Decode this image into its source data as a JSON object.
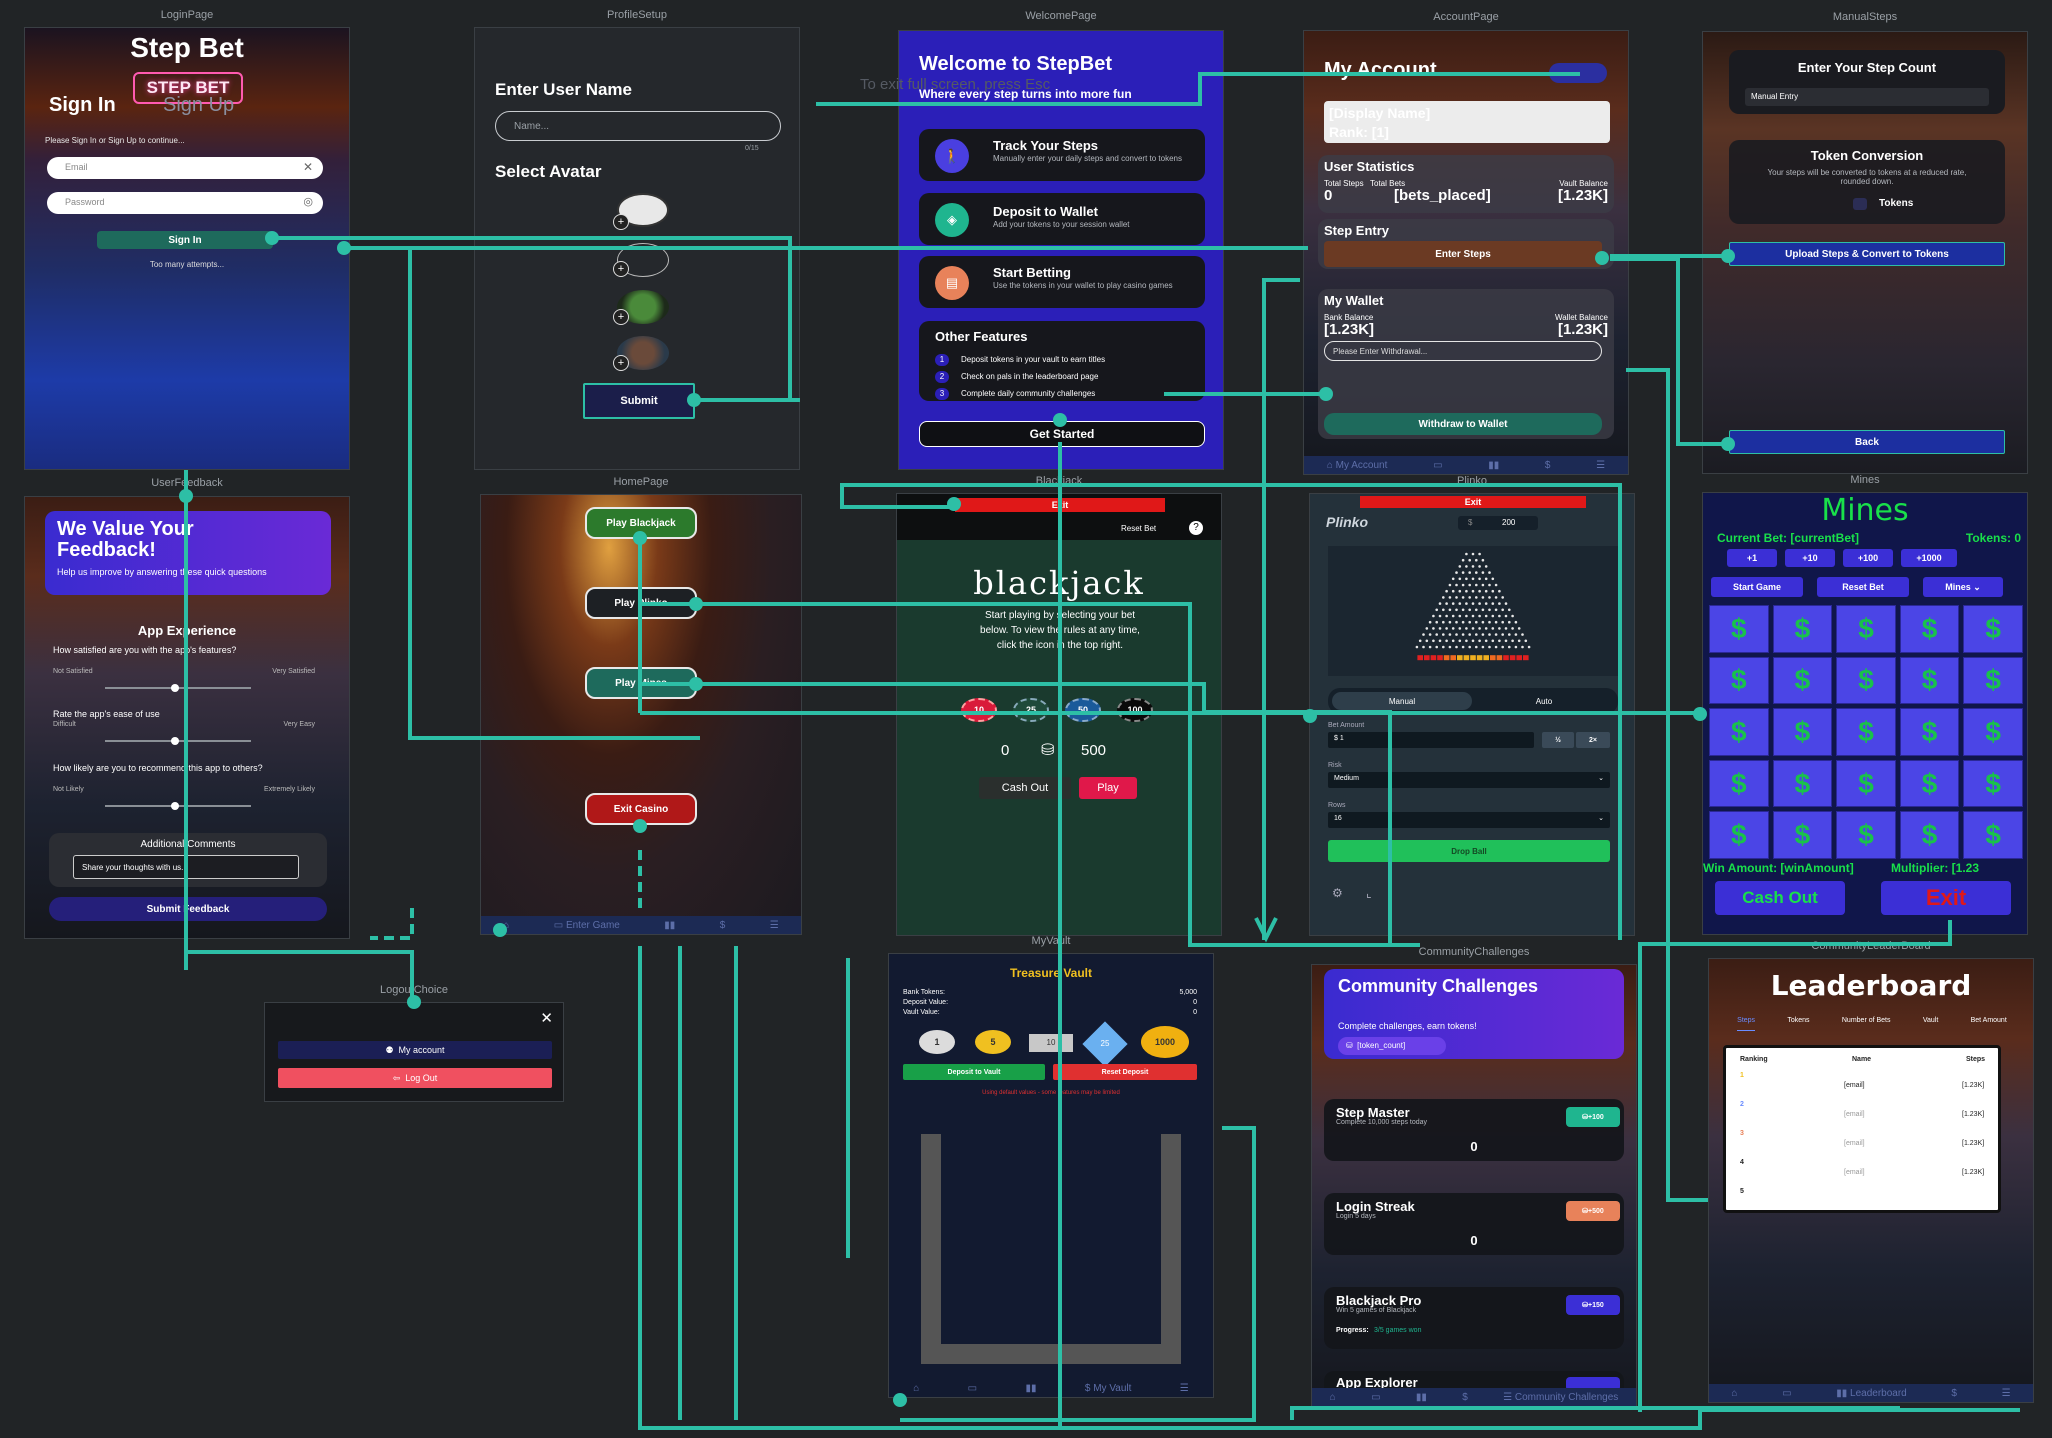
{
  "frames": {
    "login": "LoginPage",
    "profile": "ProfileSetup",
    "welcome": "WelcomePage",
    "account": "AccountPage",
    "manual": "ManualSteps",
    "feedback": "UserFeedback",
    "home": "HomePage",
    "blackjack": "Blackjack",
    "plinko": "Plinko",
    "mines": "Mines",
    "logout": "LogoutChoice",
    "vault": "MyVault",
    "community": "CommunityChallenges",
    "leaderboard": "CommunityLeaderBoard"
  },
  "login": {
    "title": "Step Bet",
    "logo": "STEP BET",
    "tab_signin": "Sign In",
    "tab_signup": "Sign Up",
    "hint": "Please Sign In or Sign Up to continue...",
    "email_placeholder": "Email",
    "password_placeholder": "Password",
    "signin_button": "Sign In",
    "error": "Too many attempts..."
  },
  "profile": {
    "username_label": "Enter User Name",
    "name_placeholder": "Name...",
    "counter": "0/15",
    "avatar_label": "Select Avatar",
    "submit": "Submit"
  },
  "welcome": {
    "title": "Welcome to StepBet",
    "subtitle": "Where every step turns into more fun",
    "overlay_hint": "To exit full screen, press  Esc",
    "features": [
      {
        "title": "Track Your Steps",
        "desc": "Manually enter your daily steps and convert to tokens"
      },
      {
        "title": "Deposit to Wallet",
        "desc": "Add your tokens to your session wallet"
      },
      {
        "title": "Start Betting",
        "desc": "Use the tokens in your wallet to play casino games"
      }
    ],
    "other_title": "Other Features",
    "other_items": [
      {
        "n": "1",
        "text": "Deposit tokens in your vault to earn titles"
      },
      {
        "n": "2",
        "text": "Check on pals in the leaderboard page"
      },
      {
        "n": "3",
        "text": "Complete daily community challenges"
      }
    ],
    "get_started": "Get Started"
  },
  "account": {
    "title": "My Account",
    "display_name": "[Display Name]",
    "rank": "Rank: [1]",
    "stats_title": "User Statistics",
    "total_steps_label": "Total Steps",
    "total_bets_label": "Total Bets",
    "vault_balance_label": "Vault Balance",
    "total_steps": "0",
    "total_bets": "[bets_placed]",
    "vault_balance": "[1.23K]",
    "step_entry_title": "Step Entry",
    "enter_steps": "Enter Steps",
    "wallet_title": "My Wallet",
    "bank_balance_label": "Bank Balance",
    "wallet_balance_label": "Wallet Balance",
    "bank_balance": "[1.23K]",
    "wallet_balance": "[1.23K]",
    "withdraw_placeholder": "Please Enter Withdrawal...",
    "withdraw_button": "Withdraw to Wallet",
    "nav_label": "My Account"
  },
  "manual": {
    "title": "Enter Your Step Count",
    "entry_placeholder": "Manual Entry",
    "conversion_title": "Token Conversion",
    "conversion_desc": "Your steps will be converted to tokens at a reduced rate, rounded down.",
    "tokens_label": "Tokens",
    "upload_button": "Upload Steps & Convert to Tokens",
    "back_button": "Back"
  },
  "feedback": {
    "title": "We Value Your Feedback!",
    "subtitle": "Help us improve by answering these quick questions",
    "section": "App Experience",
    "q1": "How satisfied are you with the app's features?",
    "q1_min": "Not Satisfied",
    "q1_max": "Very Satisfied",
    "q2": "Rate the app's ease of use",
    "q2_min": "Difficult",
    "q2_max": "Very Easy",
    "q3": "How likely are you to recommend this app to others?",
    "q3_min": "Not Likely",
    "q3_max": "Extremely Likely",
    "comments_title": "Additional Comments",
    "comments_placeholder": "Share your thoughts with us...",
    "submit": "Submit Feedback"
  },
  "home": {
    "play_blackjack": "Play Blackjack",
    "play_plinko": "Play Plinko",
    "play_mines": "Play Mines",
    "exit_casino": "Exit Casino",
    "nav_label": "Enter Game"
  },
  "blackjack": {
    "exit": "Exit",
    "reset_bet": "Reset Bet",
    "title": "blackjack",
    "description": "Start playing by selecting your bet below. To view the rules at any time, click the icon in the top right.",
    "chips": [
      "10",
      "25",
      "50",
      "100"
    ],
    "bet": "0",
    "balance": "500",
    "cash_out": "Cash Out",
    "play": "Play"
  },
  "plinko": {
    "exit": "Exit",
    "logo": "Plinko",
    "balance_value": "200",
    "tab_manual": "Manual",
    "tab_auto": "Auto",
    "bet_amount_label": "Bet Amount",
    "bet_amount": "$ 1",
    "half": "½",
    "double": "2×",
    "risk_label": "Risk",
    "risk": "Medium",
    "rows_label": "Rows",
    "rows": "16",
    "drop_ball": "Drop Ball"
  },
  "mines": {
    "title": "Mines",
    "current_bet": "Current Bet: [currentBet]",
    "tokens": "Tokens: 0",
    "increments": [
      "+1",
      "+10",
      "+100",
      "+1000"
    ],
    "start_game": "Start Game",
    "reset_bet": "Reset Bet",
    "mines_select": "Mines",
    "win_amount": "Win Amount: [winAmount]",
    "multiplier": "Multiplier: [1.23",
    "cash_out": "Cash Out",
    "exit": "Exit"
  },
  "logout": {
    "my_account": "My account",
    "log_out": "Log Out"
  },
  "vault": {
    "title": "Treasure Vault",
    "bank_tokens_label": "Bank Tokens:",
    "bank_tokens": "5,000",
    "deposit_value_label": "Deposit Value:",
    "deposit_value": "0",
    "vault_value_label": "Vault Value:",
    "vault_value": "0",
    "coins": [
      "1",
      "5",
      "10",
      "25",
      "1000"
    ],
    "deposit_button": "Deposit to Vault",
    "reset_button": "Reset Deposit",
    "warning": "Using default values - some features may be limited",
    "nav_label": "My Vault"
  },
  "community": {
    "title": "Community Challenges",
    "subtitle": "Complete challenges, earn tokens!",
    "token_count": "[token_count]",
    "challenges": [
      {
        "title": "Step Master",
        "desc": "Complete 10,000 steps today",
        "reward": "+100",
        "value": "0"
      },
      {
        "title": "Login Streak",
        "desc": "Login 5 days",
        "reward": "+500",
        "value": "0"
      },
      {
        "title": "Blackjack Pro",
        "desc": "Win 5 games of Blackjack",
        "reward": "+150",
        "progress_label": "Progress:",
        "progress": "3/5 games won"
      }
    ],
    "next_title": "App Explorer",
    "nav_label": "Community Challenges"
  },
  "leaderboard": {
    "title": "Leaderboard",
    "tabs": [
      "Steps",
      "Tokens",
      "Number of Bets",
      "Vault",
      "Bet Amount"
    ],
    "columns": [
      "Ranking",
      "Name",
      "Steps"
    ],
    "rows": [
      {
        "rank": "1",
        "name": "[email]",
        "steps": "[1.23K]"
      },
      {
        "rank": "2",
        "name": "[email]",
        "steps": "[1.23K]"
      },
      {
        "rank": "3",
        "name": "[email]",
        "steps": "[1.23K]"
      },
      {
        "rank": "4",
        "name": "[email]",
        "steps": "[1.23K]"
      },
      {
        "rank": "5",
        "name": "",
        "steps": ""
      }
    ],
    "nav_label": "Leaderboard"
  },
  "colors": {
    "connector": "#2dbfa6",
    "canvas": "#212426",
    "accent_purple": "#3b2fd6"
  }
}
